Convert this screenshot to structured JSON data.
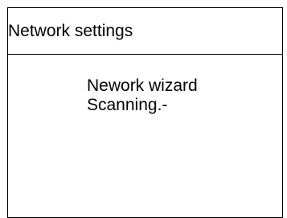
{
  "window": {
    "title": "Network settings"
  },
  "main": {
    "line1": "Nework wizard",
    "line2": "Scanning.-"
  }
}
